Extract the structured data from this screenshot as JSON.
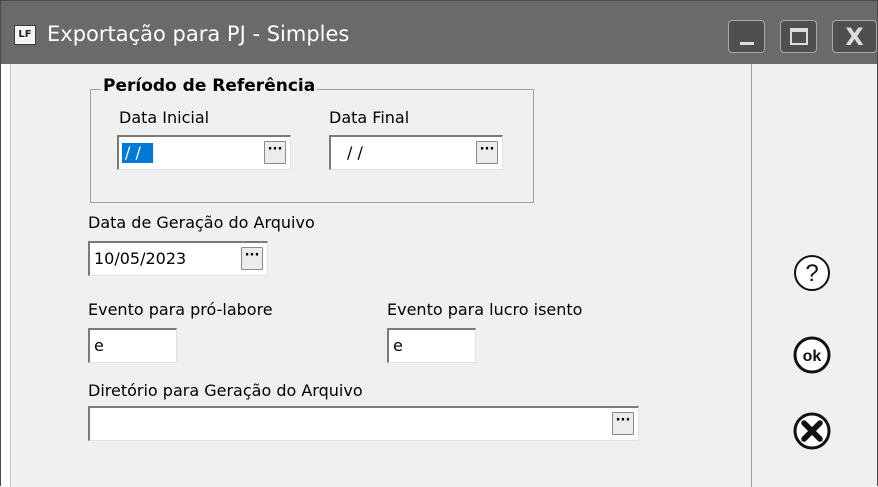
{
  "window": {
    "title": "Exportação para PJ - Simples",
    "app_icon_label": "LF",
    "minimize_glyph": "_",
    "close_glyph": "X"
  },
  "period_group": {
    "title": "Período de Referência",
    "start_label": "Data Inicial",
    "start_value": "/ /",
    "end_label": "Data Final",
    "end_value": "/ /"
  },
  "generation_date": {
    "label": "Data de Geração do Arquivo",
    "value": "10/05/2023"
  },
  "prolabore_event": {
    "label": "Evento para pró-labore",
    "value": "e"
  },
  "lucro_event": {
    "label": "Evento para lucro isento",
    "value": "e"
  },
  "directory": {
    "label": "Diretório para Geração do Arquivo",
    "value": ""
  },
  "ellipsis_glyph": "···",
  "actions": {
    "help_glyph": "?",
    "ok_glyph": "ok"
  }
}
